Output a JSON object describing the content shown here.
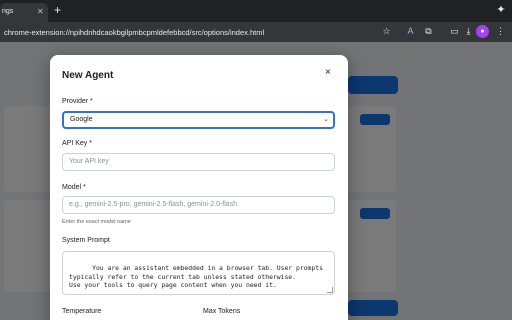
{
  "browser": {
    "tab_title": "ngs",
    "tab_close": "✕",
    "new_tab": "+",
    "url": "chrome-extension://npihdnhdcaokbgilpmbcpmldefebbcd/src/options/index.html"
  },
  "modal": {
    "title": "New Agent",
    "close": "×",
    "provider": {
      "label": "Provider *",
      "value": "Google"
    },
    "api_key": {
      "label": "API Key *",
      "placeholder": "Your API key"
    },
    "model": {
      "label": "Model *",
      "placeholder": "e.g., gemini-2.5-pro, gemini-2.5-flash, gemini-2.0-flash",
      "hint": "Enter the exact model name"
    },
    "system_prompt": {
      "label": "System Prompt",
      "value": "You are an assistant embedded in a browser tab. User prompts\ntypically refer to the current tab unless stated otherwise.\nUse your tools to query page content when you need it."
    },
    "temperature_label": "Temperature",
    "max_tokens_label": "Max Tokens"
  },
  "colors": {
    "accent": "#1a73e8",
    "focus_ring": "#2f6fde",
    "browser_dark": "#202124"
  }
}
